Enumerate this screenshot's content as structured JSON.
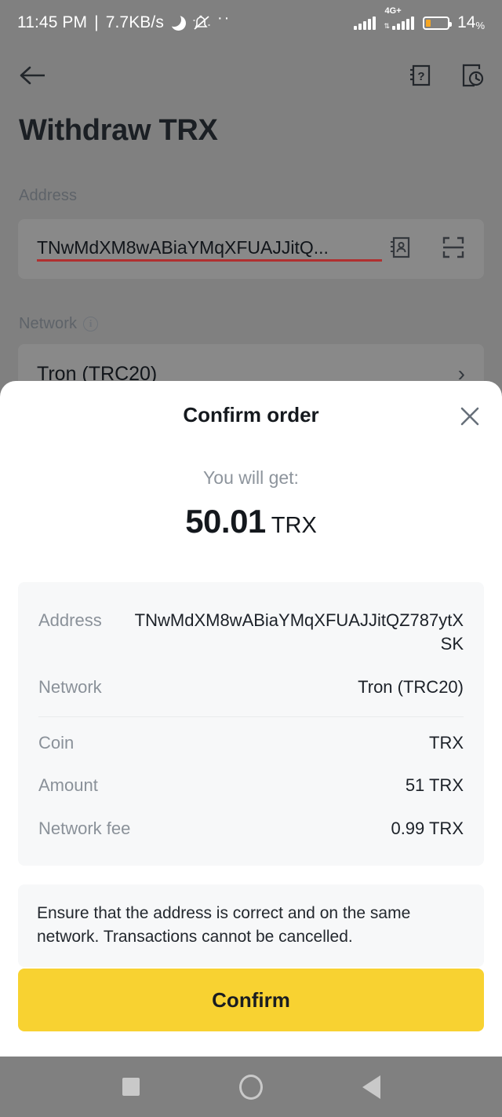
{
  "status_bar": {
    "time": "11:45 PM",
    "separator": "|",
    "network_speed": "7.7KB/s",
    "dnd_icon": "moon-icon",
    "silent_icon": "bell-muted-icon",
    "more_icon": "more-dots-icon",
    "signal_label": "4G+",
    "battery_percent": "14",
    "battery_percent_symbol": "%",
    "battery_color": "#F5A623"
  },
  "app_bar": {
    "back_icon": "back-arrow-icon",
    "faq_icon": "faq-book-icon",
    "history_icon": "transaction-history-icon"
  },
  "page": {
    "title": "Withdraw TRX",
    "address_label": "Address",
    "address_value": "TNwMdXM8wABiaYMqXFUAJJitQ...",
    "address_book_icon": "address-book-icon",
    "scan_icon": "qr-scan-icon",
    "network_label": "Network",
    "network_info_icon": "info-icon",
    "network_value": "Tron (TRC20)",
    "network_chevron_icon": "chevron-right-icon"
  },
  "modal": {
    "title": "Confirm order",
    "close_icon": "close-icon",
    "will_get_label": "You will get:",
    "amount_value": "50.01",
    "amount_unit": "TRX",
    "details": [
      {
        "key": "Address",
        "value": "TNwMdXM8wABiaYMqXFUAJJitQZ787ytXSK"
      },
      {
        "key": "Network",
        "value": "Tron (TRC20)"
      }
    ],
    "details_secondary": [
      {
        "key": "Coin",
        "value": "TRX"
      },
      {
        "key": "Amount",
        "value": "51 TRX"
      },
      {
        "key": "Network fee",
        "value": "0.99 TRX"
      }
    ],
    "warning": "Ensure that the address is correct and on the same network. Transactions cannot be cancelled.",
    "confirm_label": "Confirm",
    "confirm_color": "#F8D231"
  },
  "nav_bar": {
    "recents_icon": "recents-square-icon",
    "home_icon": "home-circle-icon",
    "back_icon": "back-triangle-icon"
  }
}
